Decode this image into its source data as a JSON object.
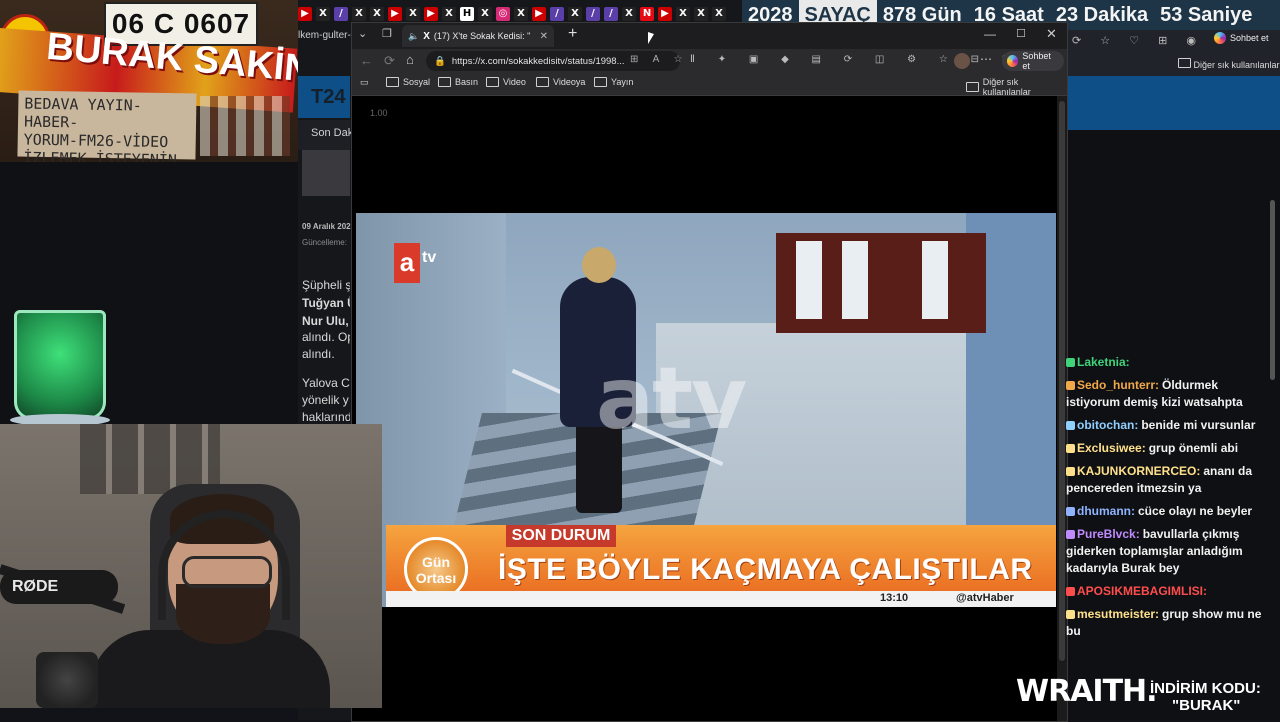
{
  "overlay_left": {
    "plate_text": "06 C 0607",
    "banner_text": "BURAK SAKİN OL",
    "cardboard_lines": [
      "BEDAVA YAYIN-HABER-",
      "YORUM-FM26-VİDEO",
      "İZLEMEK İSTEYENİN AMK"
    ],
    "mic_label": "RØDE"
  },
  "counter": {
    "year": "2028",
    "label": "SAYAÇ",
    "days": "878 Gün",
    "hours": "16 Saat",
    "minutes": "23 Dakika",
    "seconds": "53 Saniye"
  },
  "background_page": {
    "tab_fragment": "lkem-gulter-",
    "logo": "T24",
    "nav_fragment": "Son Dak",
    "date": "09 Aralık 202",
    "updated": "Güncelleme:",
    "lines": [
      "Şüpheli ş",
      "Tuğyan Ü",
      "Nur Ulu, ",
      "alındı. Op",
      "alındı.",
      "",
      "Yalova C",
      "yönelik y",
      "haklarınd"
    ],
    "bookmark_right": "Diğer sık kullanılanlar",
    "copilot_label_right": "Sohbet et"
  },
  "browser": {
    "tab_title": "(17) X'te Sokak Kedisi: \"",
    "new_tab": "+",
    "url": "https://x.com/sokakkedisitv/status/1998...",
    "copilot_label": "Sohbet et",
    "bookmarks": [
      "Sosyal",
      "Basın",
      "Video",
      "Videoya",
      "Yayın"
    ],
    "other_bookmarks": "Diğer sık kullanılanlar",
    "zoom": "1.00"
  },
  "video": {
    "logo": "a",
    "logo_suffix": "tv",
    "watermark": "atv",
    "tag": "SON DURUM",
    "badge": "Gün Ortası",
    "headline": "İŞTE BÖYLE KAÇMAYA ÇALIŞTILAR",
    "time": "13:10",
    "handle": "@atvHaber"
  },
  "chat": {
    "messages": [
      {
        "user": "Laketnia:",
        "text": "",
        "color": "#3fd37a"
      },
      {
        "user": "Sedo_hunterr:",
        "text": "Öldurmek istiyorum demiş kizi watsahpta",
        "color": "#f0a84a"
      },
      {
        "user": "obitochan:",
        "text": "benide mi vursunlar",
        "color": "#8fd0ff"
      },
      {
        "user": "Exclusiwee:",
        "text": "grup önemli abi",
        "color": "#ffe08a"
      },
      {
        "user": "KAJUNKORNERCEO:",
        "text": "ananı da pencereden itmezsin ya",
        "color": "#ffe08a"
      },
      {
        "user": "dhumann:",
        "text": "cüce olayı ne beyler",
        "color": "#8fb3ff"
      },
      {
        "user": "PureBlvck:",
        "text": "bavullarla çıkmış giderken toplamışlar anladığım kadarıyla Burak bey",
        "color": "#c08bff"
      },
      {
        "user": "APOSIKMEBAGIMLISI:",
        "text": "",
        "color": "#ff4d4d"
      },
      {
        "user": "mesutmeister:",
        "text": "grup show mu ne bu",
        "color": "#ffe08a"
      }
    ]
  },
  "sponsor": {
    "brand": "WRAITH.",
    "line1": "İNDİRİM KODU:",
    "line2": "\"BURAK\""
  }
}
